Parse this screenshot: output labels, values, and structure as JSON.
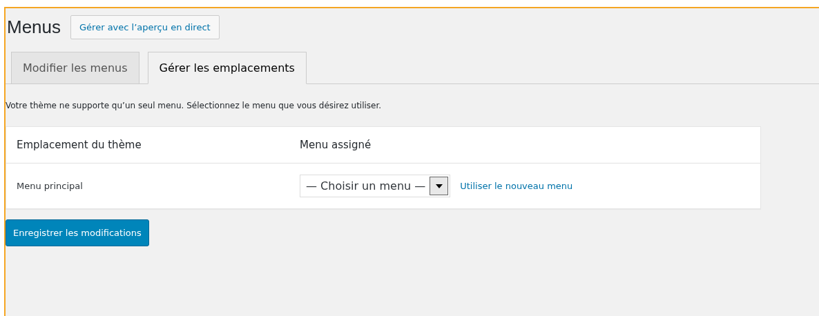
{
  "page": {
    "title": "Menus",
    "action_button": "Gérer avec l’aperçu en direct"
  },
  "tabs": [
    {
      "label": "Modifier les menus",
      "selected": false
    },
    {
      "label": "Gérer les emplacements",
      "selected": true
    }
  ],
  "notice": "Votre thème ne supporte qu’un seul menu. Sélectionnez le menu que vous désirez utiliser.",
  "table": {
    "columns": [
      "Emplacement du thème",
      "Menu assigné"
    ],
    "rows": [
      {
        "location": "Menu principal",
        "select_value": "— Choisir un menu —",
        "link": "Utiliser le nouveau menu"
      }
    ]
  },
  "save_button": "Enregistrer les modifications"
}
